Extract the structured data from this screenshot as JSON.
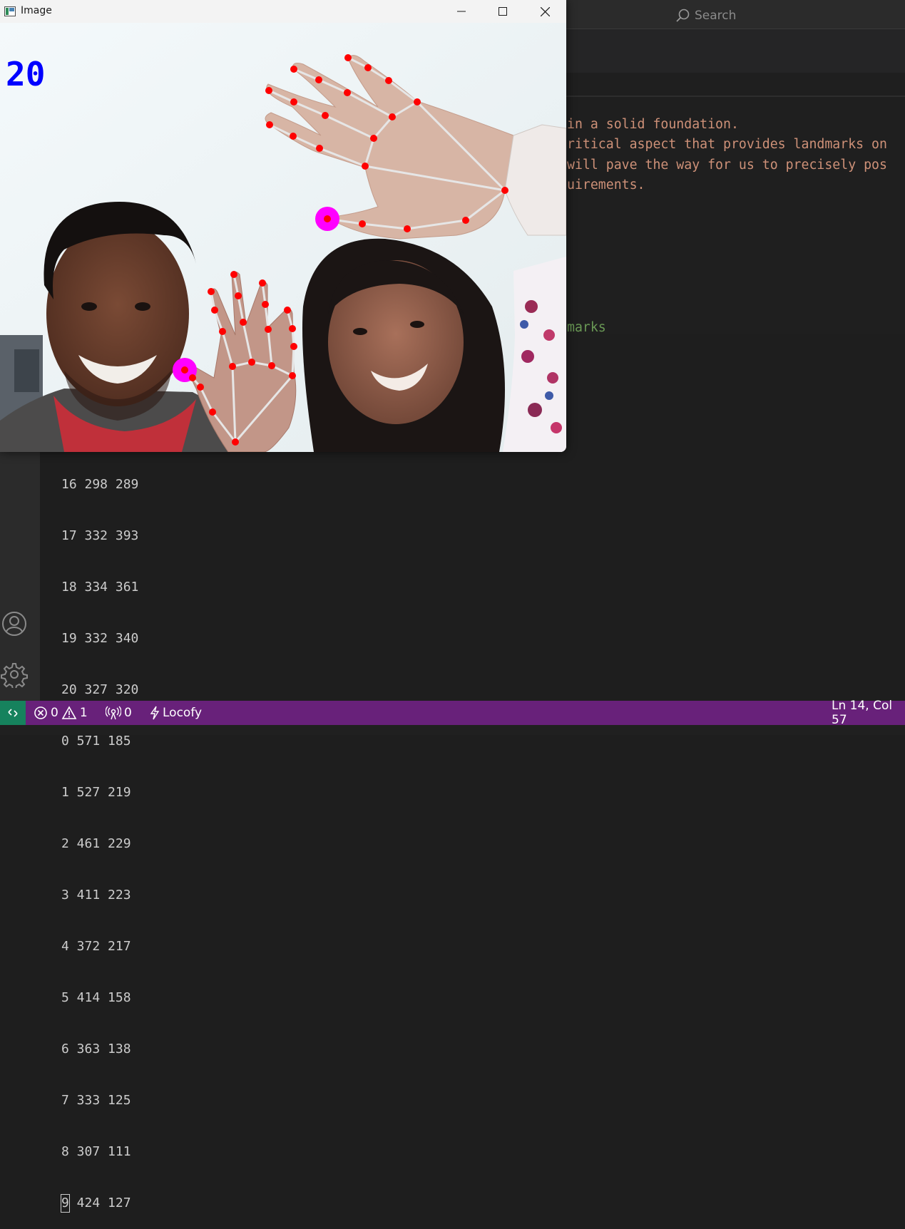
{
  "search": {
    "label": "Search"
  },
  "editor": {
    "lines": [
      "in a solid foundation.",
      "ritical aspect that provides landmarks on",
      "will pave the way for us to precisely pos",
      "uirements."
    ],
    "green_line": "marks"
  },
  "terminal": {
    "partial_line": "16 298 289",
    "lines": [
      "17 332 393",
      "18 334 361",
      "19 332 340",
      "20 327 320",
      "0 571 185",
      "1 527 219",
      "2 461 229",
      "3 411 223",
      "4 372 217",
      "5 414 158",
      "6 363 138",
      "7 333 125",
      "8 307 111"
    ],
    "cursor_char": "9",
    "last_line_rest": " 424 127"
  },
  "statusbar": {
    "errors": "0",
    "warnings": "1",
    "ports": "0",
    "extension": "Locofy",
    "position": "Ln 14, Col 57"
  },
  "image_window": {
    "title": "Image",
    "fps": "20"
  },
  "colors": {
    "statusbar_bg": "#68217a",
    "remote_bg": "#16825d",
    "fps_text": "#0000ff",
    "landmark_point": "#ff0000",
    "fingertip_marker": "#ff00ff",
    "connection_line": "#e6e6e6",
    "string_text": "#ce9178",
    "comment_text": "#6a9955"
  }
}
